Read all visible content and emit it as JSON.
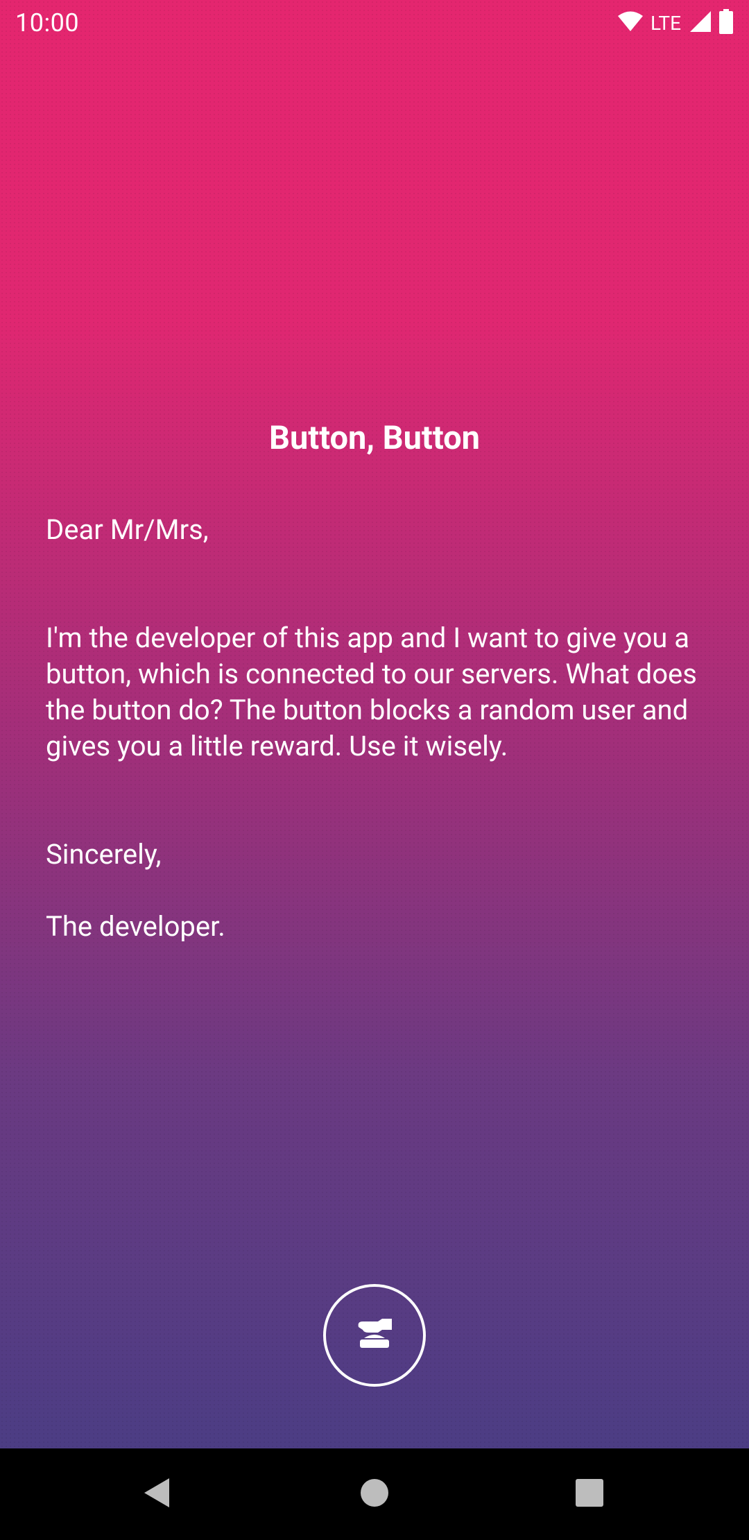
{
  "status_bar": {
    "time": "10:00",
    "network": "LTE",
    "icons": [
      "wifi-icon",
      "signal-icon",
      "battery-icon"
    ]
  },
  "letter": {
    "title": "Button, Button",
    "greeting": "Dear Mr/Mrs,",
    "body": "I'm the developer of this app and I want to give you a button, which is connected to our servers. What does the button do? The button blocks a random user and gives you a little reward. Use it wisely.",
    "closing": "Sincerely,",
    "signature": "The developer."
  },
  "action_button": {
    "icon": "hand-press-button-icon"
  },
  "nav_bar": {
    "icons": [
      "back-icon",
      "home-icon",
      "recents-icon"
    ]
  },
  "colors": {
    "gradient_top": "#e4266f",
    "gradient_bottom": "#4c3d84",
    "text": "#ffffff",
    "nav_background": "#000000"
  }
}
